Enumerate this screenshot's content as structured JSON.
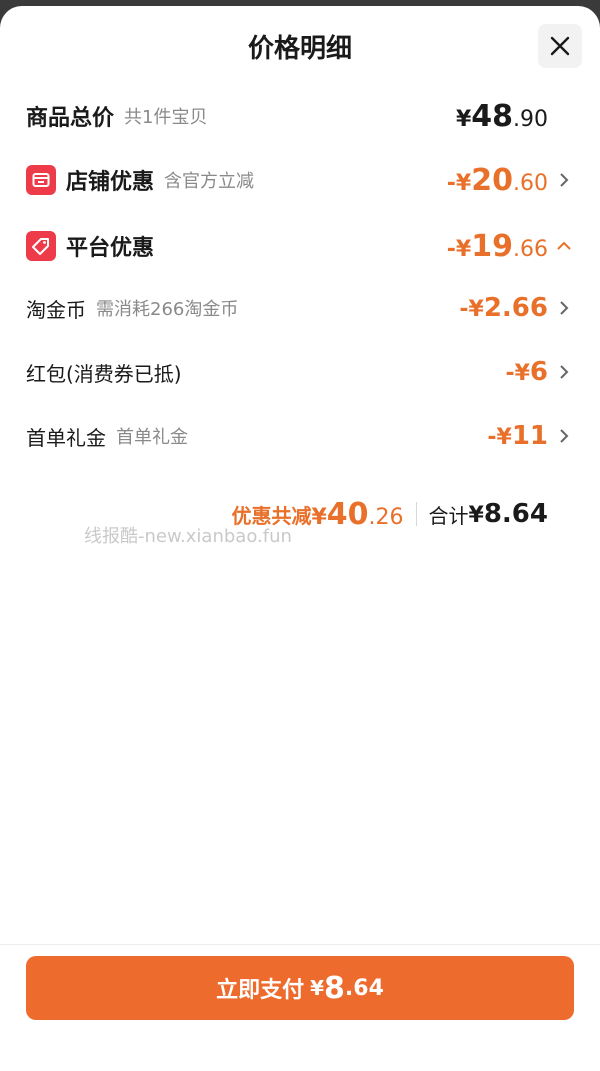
{
  "header": {
    "title": "价格明细"
  },
  "goods_total": {
    "label": "商品总价",
    "sub": "共1件宝贝",
    "currency": "¥",
    "integer": "48",
    "decimal": ".90"
  },
  "shop_discount": {
    "label": "店铺优惠",
    "sub": "含官方立减",
    "prefix": "-¥",
    "integer": "20",
    "decimal": ".60"
  },
  "platform_discount": {
    "label": "平台优惠",
    "prefix": "-¥",
    "integer": "19",
    "decimal": ".66"
  },
  "coins": {
    "label": "淘金币",
    "sub": "需消耗266淘金币",
    "prefix": "-¥",
    "value": "2.66"
  },
  "red_packet": {
    "label": "红包(消费券已抵)",
    "prefix": "-¥",
    "value": "6"
  },
  "first_order": {
    "label": "首单礼金",
    "sub": "首单礼金",
    "prefix": "-¥",
    "value": "11"
  },
  "summary": {
    "discount_label": "优惠共减",
    "discount_currency": "¥",
    "discount_integer": "40",
    "discount_decimal": ".26",
    "total_label": "合计",
    "total_currency": "¥",
    "total_value": "8.64"
  },
  "watermark": "线报酷-new.xianbao.fun",
  "pay_button": {
    "label": "立即支付",
    "currency": "¥",
    "integer": "8",
    "decimal": ".64"
  },
  "colors": {
    "accent": "#e9702a",
    "button": "#ec6b2d",
    "badge": "#ee3b4a"
  }
}
